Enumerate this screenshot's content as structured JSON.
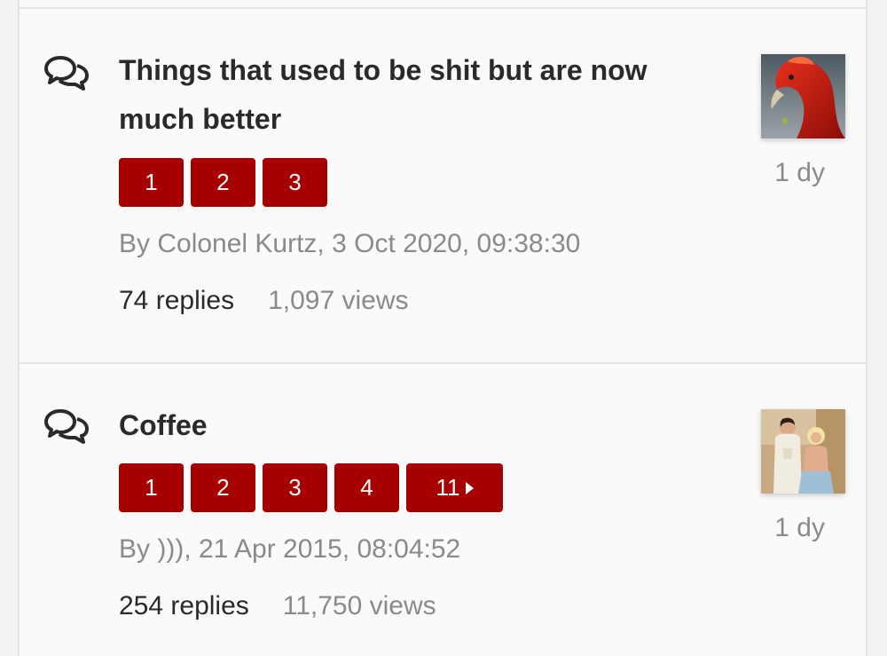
{
  "topics": [
    {
      "title": "Things that used to be shit but are now much better",
      "pages": [
        "1",
        "2",
        "3"
      ],
      "byline": "By Colonel Kurtz, 3 Oct 2020, 09:38:30",
      "replies": "74 replies",
      "views": "1,097 views",
      "age": "1 dy",
      "icon": "speech-bubbles-icon"
    },
    {
      "title": "Coffee",
      "pages": [
        "1",
        "2",
        "3",
        "4"
      ],
      "last_page": "11",
      "byline": "By ))), 21 Apr 2015, 08:04:52",
      "replies": "254 replies",
      "views": "11,750 views",
      "age": "1 dy",
      "icon": "speech-bubbles-icon"
    }
  ],
  "colors": {
    "accent": "#a60000",
    "title": "#2a2a2a",
    "muted": "#8a8a8a",
    "background": "#fafafa"
  }
}
